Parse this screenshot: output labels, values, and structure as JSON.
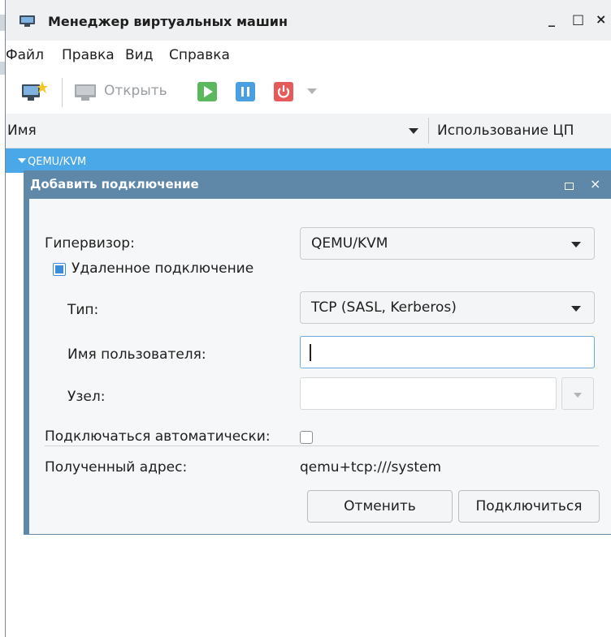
{
  "window": {
    "title": "Менеджер виртуальных машин",
    "minimize_label": "_",
    "maximize_label": "□",
    "close_label": "×"
  },
  "menu": [
    "Файл",
    "Правка",
    "Вид",
    "Справка"
  ],
  "toolbar": {
    "open_label": "Открыть",
    "icons": [
      "new-vm-icon",
      "monitor-icon",
      "play-icon",
      "pause-icon",
      "power-icon",
      "dropdown-arrow-icon"
    ],
    "colors": {
      "play": "#5cb85c",
      "pause": "#4a9fe0",
      "power": "#e65a5a"
    }
  },
  "list": {
    "columns": [
      "Имя",
      "Использование ЦП"
    ],
    "connection_row": "QEMU/KVM",
    "selection_color": "#4aa8e8"
  },
  "dialog": {
    "title": "Добавить подключение",
    "close_label": "×",
    "hypervisor_label": "Гипервизор:",
    "hypervisor_value": "QEMU/KVM",
    "remote_label": "Удаленное подключение",
    "remote_checked": true,
    "type_label": "Тип:",
    "type_value": "TCP (SASL, Kerberos)",
    "username_label": "Имя пользователя:",
    "username_value": "",
    "host_label": "Узел:",
    "host_value": "",
    "autoconnect_label": "Подключаться автоматически:",
    "autoconnect_checked": false,
    "uri_label": "Полученный адрес:",
    "uri_value": "qemu+tcp:///system",
    "cancel_label": "Отменить",
    "connect_label": "Подключиться",
    "title_color": "#5e87a8"
  }
}
